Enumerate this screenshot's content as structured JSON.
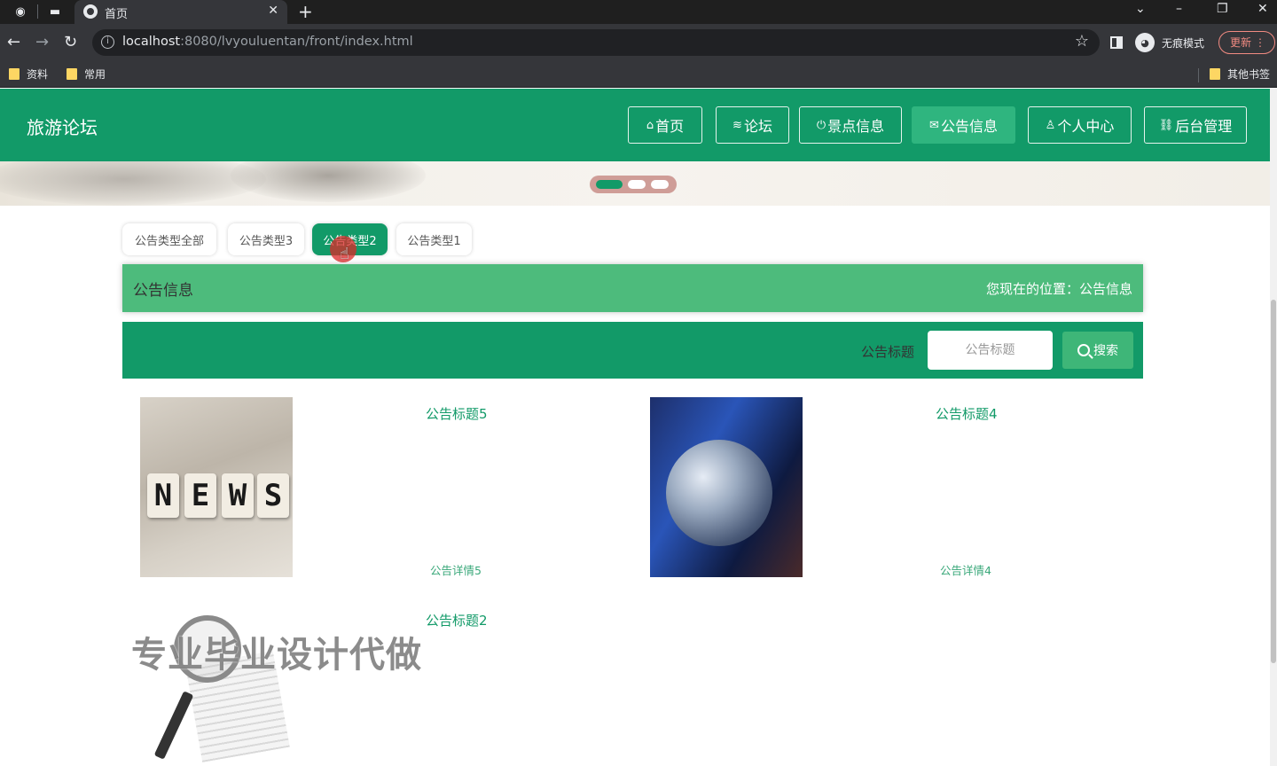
{
  "browser": {
    "tab_title": "首页",
    "url_host": "localhost",
    "url_rest": ":8080/lvyouluentan/front/index.html",
    "incognito_label": "无痕模式",
    "update_label": "更新",
    "bookmarks": [
      "资料",
      "常用"
    ],
    "other_bookmarks": "其他书签"
  },
  "header": {
    "site_title": "旅游论坛",
    "nav": [
      "首页",
      "论坛",
      "景点信息",
      "公告信息",
      "个人中心",
      "后台管理"
    ],
    "active_nav": "公告信息"
  },
  "banner": {
    "slide_count": 3,
    "active_slide": 1
  },
  "filters": {
    "tabs": [
      "公告类型全部",
      "公告类型3",
      "公告类型2",
      "公告类型1"
    ],
    "active": "公告类型2"
  },
  "section": {
    "title": "公告信息",
    "location": "您现在的位置：公告信息"
  },
  "search": {
    "label": "公告标题",
    "placeholder": "公告标题",
    "button": "搜索"
  },
  "cards": [
    {
      "title": "公告标题5",
      "detail": "公告详情5",
      "image": "news-cubes"
    },
    {
      "title": "公告标题4",
      "detail": "公告详情4",
      "image": "globe"
    },
    {
      "title": "公告标题2",
      "detail": "",
      "image": "magnifier-newspaper"
    }
  ],
  "news_letters": "NEWS",
  "watermark": "专业毕业设计代做",
  "colors": {
    "primary": "#129a68",
    "title_bar": "#4dbb7c",
    "nav_active": "#2fb57f"
  }
}
